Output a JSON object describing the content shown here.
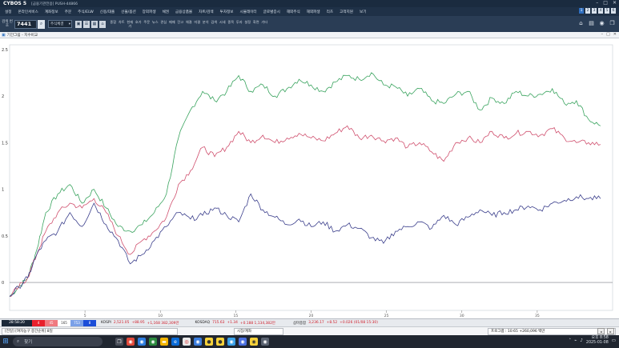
{
  "app": {
    "title": "CYBOS 5",
    "subtitle": "[금융기관전용] PUSH-44866"
  },
  "menu": [
    "설정",
    "온라인서비스",
    "계좌정보",
    "주문",
    "주식/ELW",
    "신용/대출",
    "선물/옵션",
    "장외파생",
    "채권",
    "금융상품몰",
    "차트/검색",
    "투자정보",
    "시뮬레이터",
    "글로벌증시",
    "해외주식",
    "해외파생",
    "리츠",
    "고객지원",
    "보기"
  ],
  "num_tabs": [
    "1",
    "2",
    "3",
    "4",
    "5",
    "6"
  ],
  "toolbar": {
    "left_label": "검색 번호",
    "code": "7441",
    "select": "주식체결",
    "commands": [
      "종합",
      "차트",
      "현재가",
      "호가",
      "주문",
      "뉴스",
      "관심",
      "매매",
      "잔고",
      "체결",
      "미결",
      "분석",
      "검색",
      "시세",
      "종목",
      "투자",
      "설정",
      "화면",
      "기타"
    ]
  },
  "window": {
    "title": "기간그림 - 지수비교"
  },
  "chart_data": {
    "type": "line",
    "y_ticks": [
      "2.5",
      "2",
      "1.5",
      "1",
      "0.5",
      "0"
    ],
    "ylim": [
      -0.3,
      2.55
    ],
    "x_ticks": [
      "5",
      "10",
      "15",
      "20",
      "25",
      "30",
      "35"
    ],
    "series": [
      {
        "color": "#3aa45f",
        "x": [
          0,
          0.6,
          1.2,
          1.8,
          2.4,
          3.2,
          4.0,
          4.8,
          5.6,
          6.4,
          7.2,
          8.0,
          8.8,
          9.6,
          10.4,
          11.2,
          12.0,
          12.8,
          13.6,
          14.4,
          15.2,
          16.0,
          16.8,
          17.6,
          18.4,
          19.2,
          20.0,
          20.8,
          21.6,
          22.4,
          23.2,
          24.0,
          24.8,
          25.6,
          26.4,
          27.2,
          28.0,
          28.8,
          29.6,
          30.4,
          31.2,
          32.0,
          32.8,
          33.6,
          34.4,
          35.2,
          36.0,
          36.8,
          37.6,
          38.4,
          39.2
        ],
        "values": [
          -0.15,
          -0.05,
          0.05,
          0.35,
          0.75,
          0.95,
          1.05,
          0.85,
          1.0,
          0.8,
          0.6,
          0.55,
          0.62,
          0.75,
          0.95,
          1.55,
          1.85,
          2.05,
          1.95,
          2.05,
          2.22,
          2.05,
          2.12,
          2.0,
          2.08,
          2.18,
          2.12,
          2.05,
          2.15,
          2.22,
          2.18,
          2.25,
          2.12,
          2.1,
          2.0,
          2.08,
          1.95,
          1.92,
          2.02,
          2.05,
          1.85,
          1.98,
          1.92,
          2.05,
          2.0,
          2.02,
          2.08,
          1.92,
          1.95,
          1.75,
          1.68
        ]
      },
      {
        "color": "#d0506e",
        "x": [
          0,
          0.6,
          1.2,
          1.8,
          2.4,
          3.2,
          4.0,
          4.8,
          5.6,
          6.4,
          7.2,
          8.0,
          8.8,
          9.6,
          10.4,
          11.2,
          12.0,
          12.8,
          13.6,
          14.4,
          15.2,
          16.0,
          16.8,
          17.6,
          18.4,
          19.2,
          20.0,
          20.8,
          21.6,
          22.4,
          23.2,
          24.0,
          24.8,
          25.6,
          26.4,
          27.2,
          28.0,
          28.8,
          29.6,
          30.4,
          31.2,
          32.0,
          32.8,
          33.6,
          34.4,
          35.2,
          36.0,
          36.8,
          37.6,
          38.4,
          39.2
        ],
        "values": [
          -0.15,
          -0.05,
          0.05,
          0.3,
          0.55,
          0.75,
          0.85,
          0.8,
          0.9,
          0.75,
          0.5,
          0.3,
          0.45,
          0.55,
          0.7,
          1.05,
          1.2,
          1.45,
          1.35,
          1.45,
          1.62,
          1.5,
          1.58,
          1.5,
          1.55,
          1.6,
          1.55,
          1.52,
          1.6,
          1.68,
          1.55,
          1.58,
          1.52,
          1.55,
          1.45,
          1.5,
          1.4,
          1.3,
          1.5,
          1.55,
          1.5,
          1.62,
          1.55,
          1.6,
          1.62,
          1.58,
          1.65,
          1.55,
          1.5,
          1.5,
          1.48
        ]
      },
      {
        "color": "#3b3f8c",
        "x": [
          0,
          0.6,
          1.2,
          1.8,
          2.4,
          3.2,
          4.0,
          4.8,
          5.6,
          6.4,
          7.2,
          8.0,
          8.8,
          9.6,
          10.4,
          11.2,
          12.0,
          12.8,
          13.6,
          14.4,
          15.2,
          16.0,
          16.8,
          17.6,
          18.4,
          19.2,
          20.0,
          20.8,
          21.6,
          22.4,
          23.2,
          24.0,
          24.8,
          25.6,
          26.4,
          27.2,
          28.0,
          28.8,
          29.6,
          30.4,
          31.2,
          32.0,
          32.8,
          33.6,
          34.4,
          35.2,
          36.0,
          36.8,
          37.6,
          38.4,
          39.2
        ],
        "values": [
          -0.15,
          -0.05,
          0.05,
          0.3,
          0.45,
          0.55,
          0.75,
          0.6,
          0.85,
          0.62,
          0.45,
          0.2,
          0.3,
          0.45,
          0.6,
          0.75,
          0.68,
          0.72,
          0.8,
          0.72,
          0.65,
          0.95,
          0.78,
          0.7,
          0.62,
          0.68,
          0.6,
          0.65,
          0.55,
          0.62,
          0.58,
          0.48,
          0.42,
          0.55,
          0.6,
          0.65,
          0.58,
          0.72,
          0.62,
          0.7,
          0.78,
          0.72,
          0.75,
          0.78,
          0.82,
          0.78,
          0.85,
          0.88,
          0.92,
          0.9,
          0.9
        ]
      }
    ]
  },
  "indices": {
    "time": "28:58:20",
    "boxes": [
      "4",
      "45",
      "165",
      "753",
      "8"
    ],
    "kospi": {
      "name": "KOSPI",
      "value": "2,521.05",
      "chg": "+88.95",
      "rest": "+1,168 382,309만"
    },
    "kosdaq": {
      "name": "KOSDAQ",
      "value": "715.63",
      "chg": "+1.34",
      "rest": "+0.188 1,134,382만"
    },
    "kp200": {
      "name": "삼마종합",
      "value": "3,236.17",
      "chg": "+8.52",
      "rest": "+0.026 (01/08 15:30)"
    }
  },
  "status": {
    "seg1": "[전일] [여자농구 중간순위] 8일",
    "seg2": "시장/계좌",
    "seg3": "프로그램 : 10:65 +260,096 백만"
  },
  "taskbar": {
    "search": "찾기",
    "time": "오후 8:58",
    "date": "2025-01-08"
  }
}
